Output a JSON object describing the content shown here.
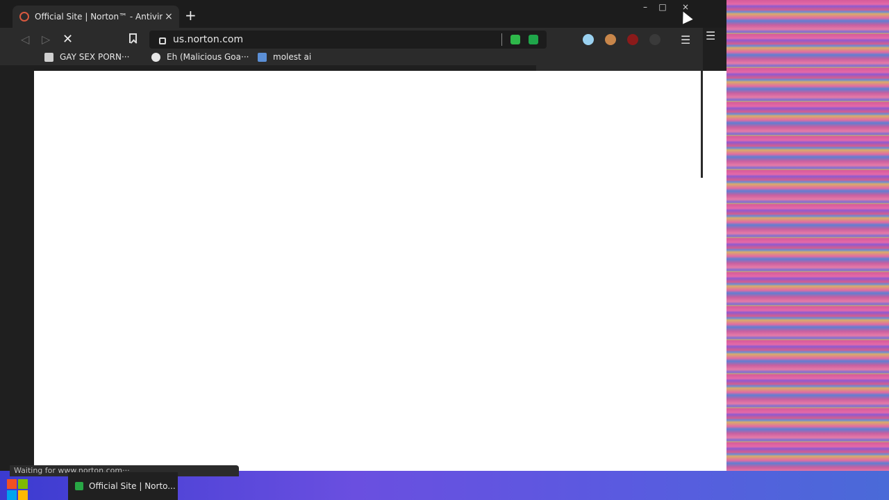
{
  "browser": {
    "tab": {
      "title": "Official Site | Norton™ - Antiviru",
      "close": "×"
    },
    "new_tab": "+",
    "window_controls": {
      "minimize": "–",
      "maximize": "□",
      "close": "×"
    },
    "toolbar": {
      "back": "◁",
      "forward": "▷",
      "stop": "✕",
      "url": "us.norton.com",
      "menu": "☰"
    },
    "bookmarks": [
      {
        "label": "GAY SEX PORN···",
        "icon": "bookmark-favicon",
        "color": "#cfcfcf"
      },
      {
        "label": "Eh (Malicious Goa···",
        "icon": "globe-icon",
        "color": "#e8e8e8"
      },
      {
        "label": "molest ai",
        "icon": "site-favicon",
        "color": "#5b8fd6"
      }
    ],
    "extensions": [
      {
        "name": "trans-flag-ext",
        "color": "#9ad1f0"
      },
      {
        "name": "avatar-ext",
        "color": "#c8864a"
      },
      {
        "name": "ublock-ext",
        "color": "#8b1a1a"
      },
      {
        "name": "grey-ext",
        "color": "#3a3a3a"
      }
    ],
    "url_extensions": [
      {
        "name": "green-chat-ext",
        "color": "#2eb84a"
      },
      {
        "name": "green-shield-ext",
        "color": "#1fa64a"
      }
    ],
    "status": "Waiting for www.norton.com···"
  },
  "desktop": {
    "outer_menu": "☰",
    "taskbar_item": "Official Site | Norto..."
  },
  "colors": {
    "window_bg": "#1f1f1f",
    "toolbar_bg": "#2b2b2b",
    "content_bg": "#ffffff"
  }
}
